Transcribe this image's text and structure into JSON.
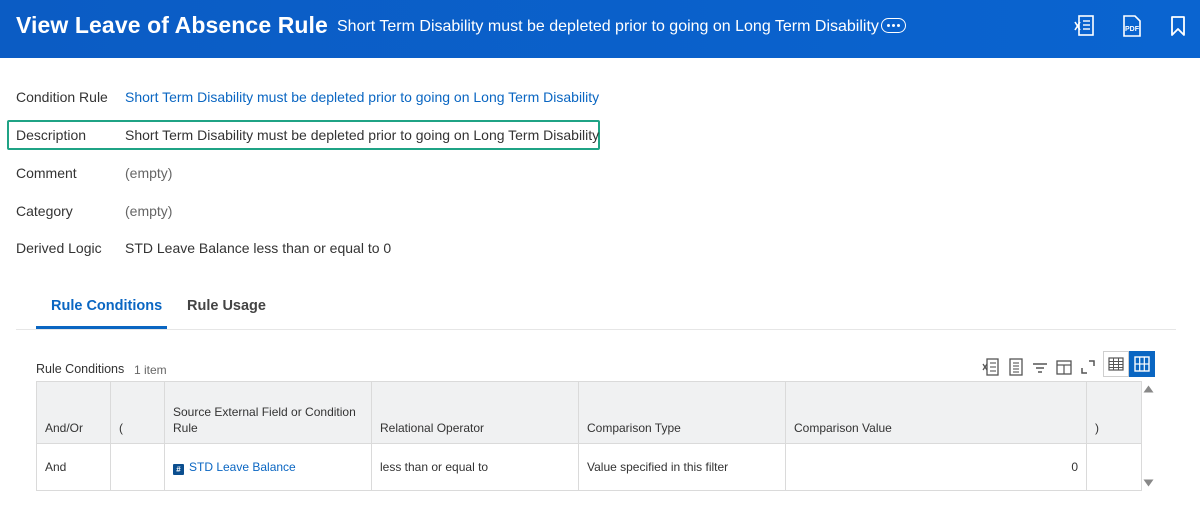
{
  "header": {
    "title": "View Leave of Absence Rule",
    "subtitle": "Short Term Disability must be depleted prior to going on Long Term Disability",
    "icons": [
      "export-to-excel-icon",
      "export-to-pdf-icon",
      "bookmark-icon"
    ],
    "pdf_label": "PDF",
    "background_color": "#0b5cc4"
  },
  "fields": [
    {
      "label": "Condition Rule",
      "value": "Short Term Disability must be depleted prior to going on Long Term Disability",
      "is_link": true
    },
    {
      "label": "Description",
      "value": "Short Term Disability must be depleted prior to going on Long Term Disability",
      "is_link": false,
      "highlighted": true
    },
    {
      "label": "Comment",
      "value": "(empty)",
      "is_link": false
    },
    {
      "label": "Category",
      "value": "(empty)",
      "is_link": false
    },
    {
      "label": "Derived Logic",
      "value": "STD Leave Balance less than or equal to 0",
      "is_link": false
    }
  ],
  "tabs": [
    {
      "label": "Rule Conditions",
      "active": true
    },
    {
      "label": "Rule Usage",
      "active": false
    }
  ],
  "grid": {
    "title": "Rule Conditions",
    "count": "1 item",
    "toolbar_icons": [
      "export-excel-icon",
      "export-pdf-icon",
      "filter-icon",
      "column-config-icon",
      "fullscreen-icon",
      "table-view-icon",
      "grid-view-icon"
    ],
    "columns": [
      "And/Or",
      "(",
      "Source External Field or Condition Rule",
      "Relational Operator",
      "Comparison Type",
      "Comparison Value",
      ")"
    ],
    "rows": [
      {
        "and_or": "And",
        "open_paren": "",
        "source_badge": "#",
        "source": "STD Leave Balance",
        "operator": "less than or equal to",
        "comparison_type": "Value specified in this filter",
        "comparison_value": "0",
        "close_paren": ""
      }
    ]
  },
  "colors": {
    "link": "#0a66c2",
    "highlight_border": "#1fa385",
    "header_bg": "#0b5cc4"
  }
}
